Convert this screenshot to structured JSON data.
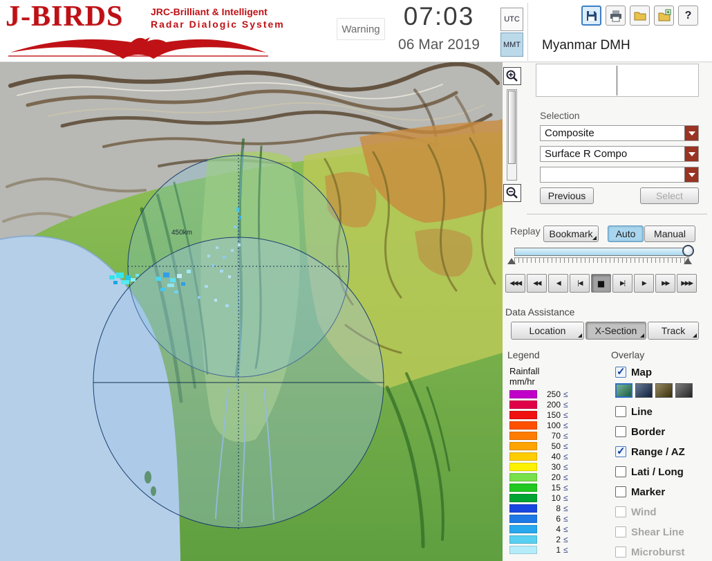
{
  "header": {
    "logo": {
      "title": "J-BIRDS",
      "subtitle_line1": "JRC-Brilliant & Intelligent",
      "subtitle_line2": "Radar Dialogic System"
    },
    "warning_label": "Warning",
    "clock": {
      "time": "07:03",
      "date": "06 Mar 2019"
    },
    "timezone": {
      "utc_label": "UTC",
      "mmt_label": "MMT",
      "selected": "MMT"
    },
    "toolbar": {
      "help_glyph": "?"
    },
    "site_title": "Myanmar DMH"
  },
  "map": {
    "range_label": "450km"
  },
  "panel": {
    "selection": {
      "label": "Selection",
      "dropdown1": "Composite",
      "dropdown2": "Surface R Compo",
      "dropdown3": "",
      "previous_label": "Previous",
      "select_label": "Select"
    },
    "replay": {
      "label": "Replay",
      "bookmark": "Bookmark",
      "auto": "Auto",
      "manual": "Manual",
      "selected_mode": "Auto",
      "transport": [
        "◀◀◀",
        "◀◀",
        "◀",
        "|◀",
        "■",
        "▶|",
        "▶",
        "▶▶",
        "▶▶▶"
      ]
    },
    "data_assistance": {
      "label": "Data Assistance",
      "location": "Location",
      "xsection": "X-Section",
      "track": "Track",
      "pressed": "X-Section"
    },
    "legend": {
      "label": "Legend",
      "unit_line1": "Rainfall",
      "unit_line2": "mm/hr",
      "leq": "≤",
      "rows": [
        {
          "value": "250",
          "color": "#c000c8"
        },
        {
          "value": "200",
          "color": "#e00048"
        },
        {
          "value": "150",
          "color": "#f01010"
        },
        {
          "value": "100",
          "color": "#ff5000"
        },
        {
          "value": "70",
          "color": "#ff7c00"
        },
        {
          "value": "50",
          "color": "#ffa400"
        },
        {
          "value": "40",
          "color": "#ffcc00"
        },
        {
          "value": "30",
          "color": "#fff200"
        },
        {
          "value": "20",
          "color": "#78e04a"
        },
        {
          "value": "15",
          "color": "#20c820"
        },
        {
          "value": "10",
          "color": "#00a432"
        },
        {
          "value": "8",
          "color": "#1846e0"
        },
        {
          "value": "6",
          "color": "#1e78e6"
        },
        {
          "value": "4",
          "color": "#28a8ee"
        },
        {
          "value": "2",
          "color": "#58d0f2"
        },
        {
          "value": "1",
          "color": "#b4ecfa"
        }
      ]
    },
    "overlay": {
      "label": "Overlay",
      "map_styles": [
        {
          "name": "green-map",
          "color": "#2e8f66",
          "selected": true
        },
        {
          "name": "navy-map",
          "color": "#16315c",
          "selected": false
        },
        {
          "name": "olive-map",
          "color": "#59490f",
          "selected": false
        },
        {
          "name": "gray-map",
          "color": "#3a3a3a",
          "selected": false
        }
      ],
      "items": [
        {
          "label": "Map",
          "checked": true,
          "enabled": true
        },
        {
          "label": "Line",
          "checked": false,
          "enabled": true
        },
        {
          "label": "Border",
          "checked": false,
          "enabled": true
        },
        {
          "label": "Range / AZ",
          "checked": true,
          "enabled": true
        },
        {
          "label": "Lati / Long",
          "checked": false,
          "enabled": true
        },
        {
          "label": "Marker",
          "checked": false,
          "enabled": true
        },
        {
          "label": "Wind",
          "checked": false,
          "enabled": false
        },
        {
          "label": "Shear Line",
          "checked": false,
          "enabled": false
        },
        {
          "label": "Microburst",
          "checked": false,
          "enabled": false
        }
      ]
    }
  }
}
